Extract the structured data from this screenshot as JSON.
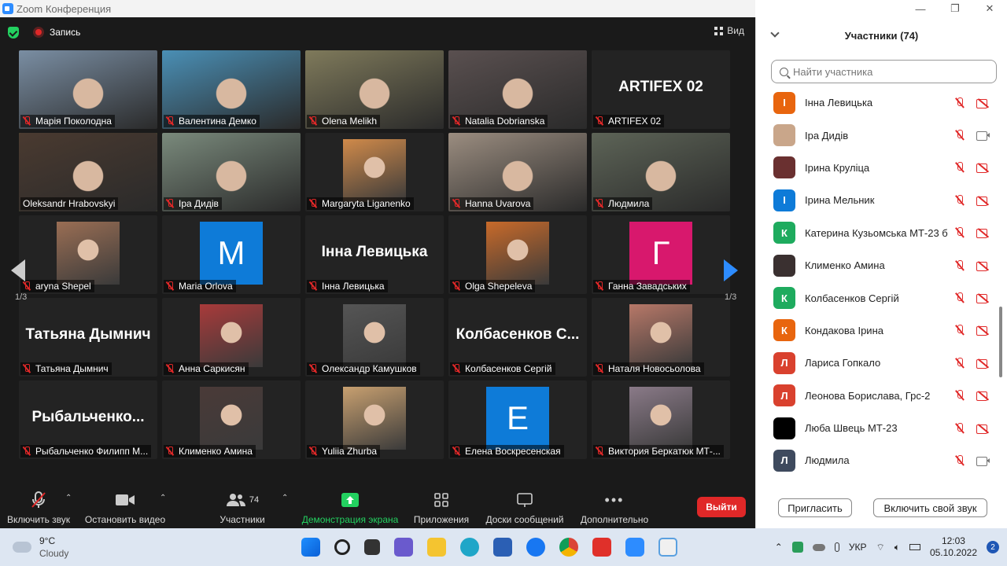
{
  "window": {
    "title": "Zoom Конференция",
    "controls": [
      "—",
      "❐",
      "✕"
    ]
  },
  "meeting": {
    "record_label": "Запись",
    "view_label": "Вид",
    "page_indicator": "1/3",
    "tiles": [
      {
        "label": "Марія Поколодна",
        "kind": "video",
        "bg": "#7a8ea3"
      },
      {
        "label": "Валентина Демко",
        "kind": "video",
        "bg": "#4a8fb5"
      },
      {
        "label": "Olena Melikh",
        "kind": "video",
        "bg": "#7f7a5b"
      },
      {
        "label": "Natalia Dobrianska",
        "kind": "video",
        "bg": "#5a5050"
      },
      {
        "label": "ARTIFEX 02",
        "kind": "name",
        "bigname": "ARTIFEX 02"
      },
      {
        "label": "Oleksandr Hrabovskyi",
        "kind": "video",
        "bg": "#4a3a30",
        "active": true
      },
      {
        "label": "Іра Дидів",
        "kind": "video",
        "bg": "#7a8a7c"
      },
      {
        "label": "Margaryta Liganenko",
        "kind": "photo",
        "bg": "#d08a4a"
      },
      {
        "label": "Hanna Uvarova",
        "kind": "video",
        "bg": "#9b8d80"
      },
      {
        "label": "Людмила",
        "kind": "video",
        "bg": "#5d6457"
      },
      {
        "label": "aryna Shepel",
        "kind": "photo",
        "bg": "#9a6e54"
      },
      {
        "label": "Maria Orlova",
        "kind": "letter",
        "letter": "M",
        "color": "#0e7bd8"
      },
      {
        "label": "Інна Левицька",
        "kind": "name",
        "bigname": "Інна Левицька"
      },
      {
        "label": "Olga Shepeleva",
        "kind": "photo",
        "bg": "#c86a2a"
      },
      {
        "label": "Ганна Завадських",
        "kind": "letter",
        "letter": "Г",
        "color": "#d8186d"
      },
      {
        "label": "Татьяна Дымнич",
        "kind": "name",
        "bigname": "Татьяна Дымнич"
      },
      {
        "label": "Анна Саркисян",
        "kind": "photo",
        "bg": "#a83a3a"
      },
      {
        "label": "Олександр Камушков",
        "kind": "photo",
        "bg": "#555555"
      },
      {
        "label": "Колбасенков Сергій",
        "kind": "name",
        "bigname": "Колбасенков  С..."
      },
      {
        "label": "Наталя Новосьолова",
        "kind": "photo",
        "bg": "#b77868"
      },
      {
        "label": "Рыбальченко Филипп М...",
        "kind": "name",
        "bigname": "Рыбальченко..."
      },
      {
        "label": "Клименко Амина",
        "kind": "photo",
        "bg": "#4a3a38"
      },
      {
        "label": "Yuliia Zhurba",
        "kind": "photo",
        "bg": "#c8a070"
      },
      {
        "label": "Елена Воскресенская",
        "kind": "letter",
        "letter": "E",
        "color": "#0e7bd8"
      },
      {
        "label": "Виктория Беркатюк МТ-...",
        "kind": "photo",
        "bg": "#8a7a88"
      }
    ]
  },
  "toolbar": {
    "mute": "Включить звук",
    "video": "Остановить видео",
    "participants": "Участники",
    "participants_count": "74",
    "share": "Демонстрация экрана",
    "apps": "Приложения",
    "whiteboards": "Доски сообщений",
    "more": "Дополнительно",
    "leave": "Выйти"
  },
  "panel": {
    "title": "Участники (74)",
    "search_placeholder": "Найти участника",
    "invite": "Пригласить",
    "unmute_me": "Включить свой звук",
    "participants": [
      {
        "name": "Інна Левицька",
        "initial": "І",
        "color": "#e8650e",
        "cam": "off"
      },
      {
        "name": "Іра Дидів",
        "initial": "",
        "color": "#c9a68a",
        "cam": "on"
      },
      {
        "name": "Ірина Круліца",
        "initial": "",
        "color": "#6a3030",
        "cam": "off"
      },
      {
        "name": "Ірина Мельник",
        "initial": "І",
        "color": "#0e7bd8",
        "cam": "off"
      },
      {
        "name": "Катерина Кузьомська МТ-23 б",
        "initial": "К",
        "color": "#1eab5e",
        "cam": "off"
      },
      {
        "name": "Клименко Амина",
        "initial": "",
        "color": "#3a3030",
        "cam": "off"
      },
      {
        "name": "Колбасенков Сергій",
        "initial": "К",
        "color": "#1eab5e",
        "cam": "off"
      },
      {
        "name": "Кондакова Ірина",
        "initial": "К",
        "color": "#e8650e",
        "cam": "off"
      },
      {
        "name": "Лариса Гопкало",
        "initial": "Л",
        "color": "#d9412e",
        "cam": "off"
      },
      {
        "name": "Леонова Борислава, Грс-2",
        "initial": "Л",
        "color": "#d9412e",
        "cam": "off"
      },
      {
        "name": "Люба Швець МТ-23",
        "initial": "",
        "color": "#000000",
        "cam": "off"
      },
      {
        "name": "Людмила",
        "initial": "Л",
        "color": "#3e4a5e",
        "cam": "on"
      }
    ]
  },
  "taskbar": {
    "temp": "9°C",
    "weather": "Cloudy",
    "lang": "УКР",
    "time": "12:03",
    "date": "05.10.2022",
    "notifications": "2"
  }
}
